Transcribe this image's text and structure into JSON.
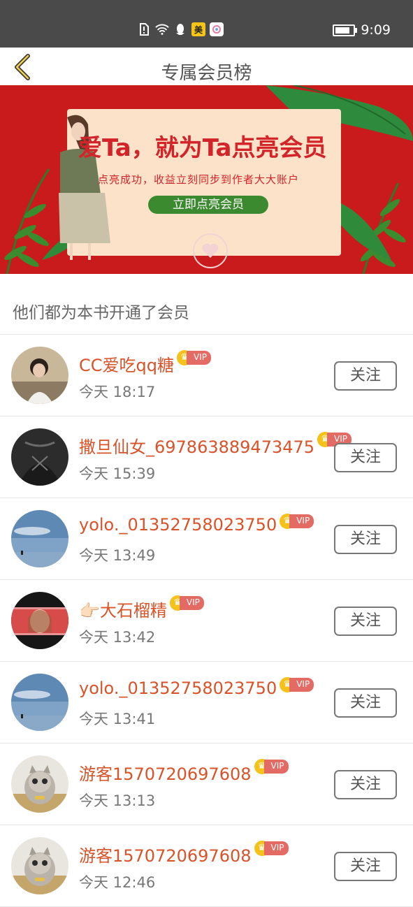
{
  "status_bar": {
    "time": "9:09",
    "icons": [
      "sim-alert-icon",
      "wifi-icon",
      "qq-icon",
      "meituan-icon",
      "app-icon"
    ],
    "meituan_label": "美"
  },
  "nav": {
    "title": "专属会员榜"
  },
  "banner": {
    "headline": "爱Ta，就为Ta点亮会员",
    "subline": "点亮成功，收益立刻同步到作者大大账户",
    "cta": "立即点亮会员"
  },
  "section": {
    "title": "他们都为本书开通了会员"
  },
  "vip_label": "VIP",
  "follow_label": "关注",
  "members": [
    {
      "name": "CC爱吃qq糖",
      "time": "今天 18:17",
      "avatar": "girl-photo"
    },
    {
      "name": "撒旦仙女_697863889473475",
      "time": "今天 15:39",
      "avatar": "dark-outfit"
    },
    {
      "name": "yolo._01352758023750",
      "time": "今天 13:49",
      "avatar": "sky-sea"
    },
    {
      "name": "👉🏻大石榴精",
      "time": "今天 13:42",
      "avatar": "film-portrait"
    },
    {
      "name": "yolo._01352758023750",
      "time": "今天 13:41",
      "avatar": "sky-sea"
    },
    {
      "name": "游客1570720697608",
      "time": "今天 13:13",
      "avatar": "kitten"
    },
    {
      "name": "游客1570720697608",
      "time": "今天 12:46",
      "avatar": "kitten"
    }
  ]
}
